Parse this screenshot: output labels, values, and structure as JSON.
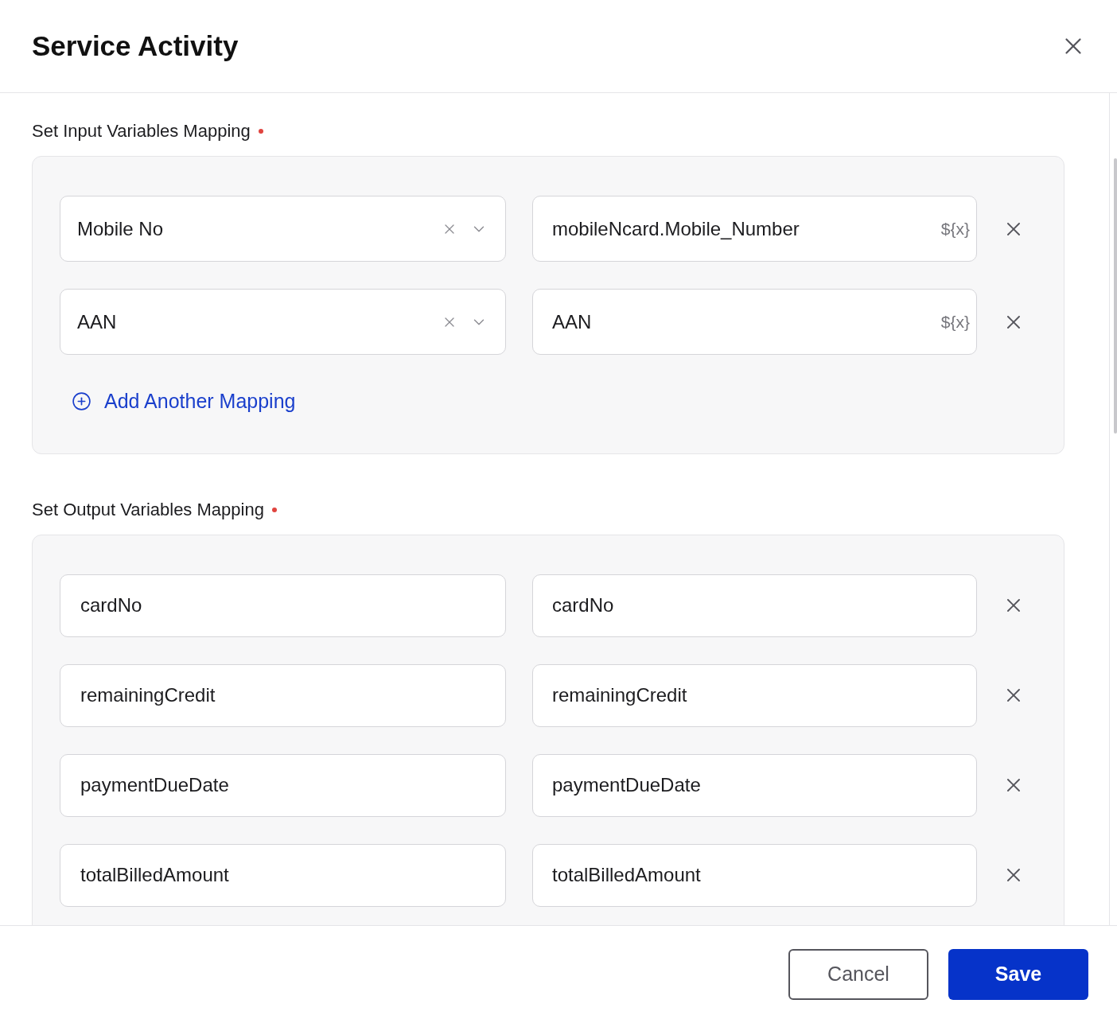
{
  "dialog": {
    "title": "Service Activity"
  },
  "input_section": {
    "label": "Set Input Variables Mapping",
    "required": true,
    "rows": [
      {
        "variable": "Mobile No",
        "value": "mobileNcard.Mobile_Number",
        "suffix": "${x}"
      },
      {
        "variable": "AAN",
        "value": "AAN",
        "suffix": "${x}"
      }
    ],
    "add_link": "Add Another Mapping"
  },
  "output_section": {
    "label": "Set Output Variables Mapping",
    "required": true,
    "rows": [
      {
        "source": "cardNo",
        "target": "cardNo"
      },
      {
        "source": "remainingCredit",
        "target": "remainingCredit"
      },
      {
        "source": "paymentDueDate",
        "target": "paymentDueDate"
      },
      {
        "source": "totalBilledAmount",
        "target": "totalBilledAmount"
      }
    ]
  },
  "buttons": {
    "cancel": "Cancel",
    "save": "Save"
  }
}
